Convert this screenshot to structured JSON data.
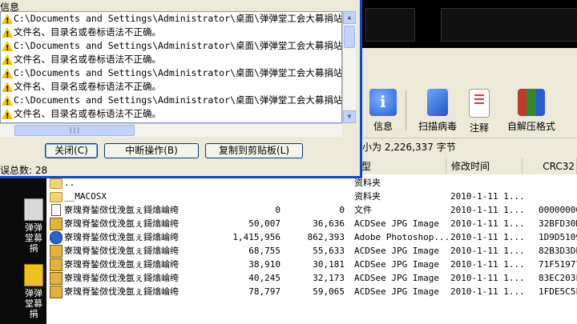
{
  "dialog": {
    "title": "信息",
    "messages": [
      "C:\\Documents and Settings\\Administrator\\桌面\\弹弹堂工会大募捐站长推广",
      "文件名、目录名或卷标语法不正确。",
      "C:\\Documents and Settings\\Administrator\\桌面\\弹弹堂工会大募捐站长推广",
      "文件名、目录名或卷标语法不正确。",
      "C:\\Documents and Settings\\Administrator\\桌面\\弹弹堂工会大募捐站长推广",
      "文件名、目录名或卷标语法不正确。",
      "C:\\Documents and Settings\\Administrator\\桌面\\弹弹堂工会大募捐站长推广",
      "文件名、目录名或卷标语法不正确。"
    ],
    "buttons": {
      "close": "关闭(C)",
      "abort": "中断操作(B)",
      "copy": "复制到剪贴板(L)"
    },
    "error_count": "误总数: 28"
  },
  "toolbar": {
    "info": "信息",
    "scan": "扫描病毒",
    "comment": "注释",
    "sfx": "自解压格式"
  },
  "status": {
    "size_text": "小为 2,226,337 字节"
  },
  "columns": {
    "type": "型",
    "modified": "修改时间",
    "crc": "CRC32"
  },
  "files": [
    {
      "name": "..",
      "size": "",
      "packed": "",
      "type": "资料夹",
      "modified": "",
      "crc": "",
      "icon": "folder"
    },
    {
      "name": "__MACOSX",
      "size": "",
      "packed": "",
      "type": "资料夹",
      "modified": "2010-1-11 1...",
      "crc": "",
      "icon": "folder"
    },
    {
      "name": "寮瑰脊鍫傚伐浼氬ぇ鎶熻崘绔",
      "size": "0",
      "packed": "0",
      "type": "文件",
      "modified": "2010-1-11 1...",
      "crc": "00000000",
      "icon": "file"
    },
    {
      "name": "寮瑰脊鍫傚伐浼氬ぇ鎶熻崘绔",
      "size": "50,007",
      "packed": "36,636",
      "type": "ACDSee JPG Image",
      "modified": "2010-1-11 1...",
      "crc": "32BFD30D",
      "icon": "jpg"
    },
    {
      "name": "寮瑰脊鍫傚伐浼氬ぇ鎶熻崘绔",
      "size": "1,415,956",
      "packed": "862,393",
      "type": "Adobe Photoshop...",
      "modified": "2010-1-11 1...",
      "crc": "1D9D5109",
      "icon": "psd"
    },
    {
      "name": "寮瑰脊鍫傚伐浼氬ぇ鎶熻崘绔",
      "size": "68,755",
      "packed": "55,633",
      "type": "ACDSee JPG Image",
      "modified": "2010-1-11 1...",
      "crc": "82B3D3DE",
      "icon": "jpg"
    },
    {
      "name": "寮瑰脊鍫傚伐浼氬ぇ鎶熻崘绔",
      "size": "38,910",
      "packed": "30,181",
      "type": "ACDSee JPG Image",
      "modified": "2010-1-11 1...",
      "crc": "71F51977",
      "icon": "jpg"
    },
    {
      "name": "寮瑰脊鍫傚伐浼氬ぇ鎶熻崘绔",
      "size": "40,245",
      "packed": "32,173",
      "type": "ACDSee JPG Image",
      "modified": "2010-1-11 1...",
      "crc": "83EC203F",
      "icon": "jpg"
    },
    {
      "name": "寮瑰脊鍫傚伐浼氬ぇ鎶熻崘绔",
      "size": "78,797",
      "packed": "59,065",
      "type": "ACDSee JPG Image",
      "modified": "2010-1-11 1...",
      "crc": "1FDE5C5F",
      "icon": "jpg"
    }
  ],
  "desktop": {
    "icon1": "弹弹堂募捐",
    "icon2": "弹弹堂募捐"
  }
}
